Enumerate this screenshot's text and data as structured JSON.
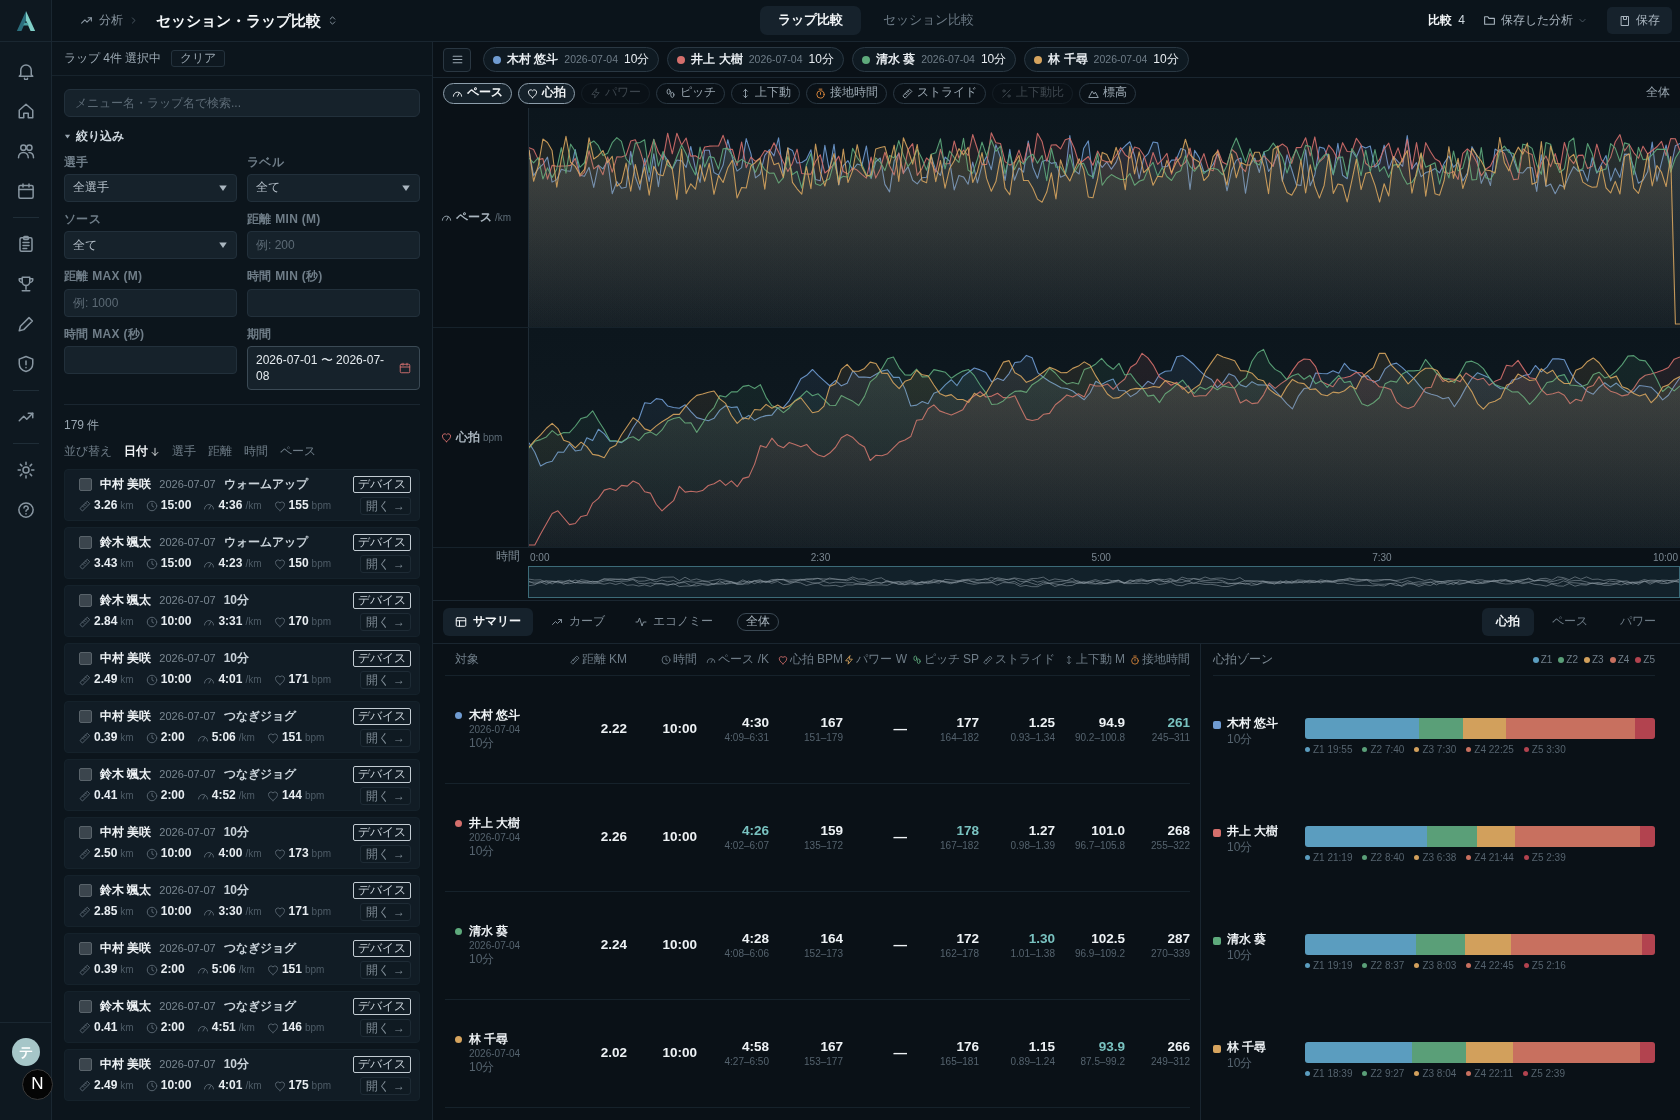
{
  "header": {
    "breadcrumb_parent": "分析",
    "title": "セッション・ラップ比較",
    "mode_tabs": [
      {
        "label": "ラップ比較",
        "selected": true
      },
      {
        "label": "セッション比較",
        "selected": false
      }
    ],
    "compare_label": "比較",
    "compare_count": "4",
    "saved_menu": "保存した分析",
    "save_button": "保存"
  },
  "sidebar": {
    "user_avatar": "テ",
    "dev_badge": "N"
  },
  "lap_panel": {
    "selection_text": "ラップ 4件 選択中",
    "clear_button": "クリア",
    "search": {
      "placeholder": "メニュー名・ラップ名で検索..."
    },
    "filter_toggle": {
      "label": "絞り込み",
      "expanded": true
    },
    "filters": [
      {
        "kind": "select",
        "label": "選手",
        "value": "全選手"
      },
      {
        "kind": "select",
        "label": "ラベル",
        "value": "全て"
      },
      {
        "kind": "select",
        "label": "ソース",
        "value": "全て"
      },
      {
        "kind": "input",
        "label": "距離 MIN (M)",
        "placeholder": "例: 200"
      },
      {
        "kind": "input",
        "label": "距離 MAX (M)",
        "placeholder": "例: 1000"
      },
      {
        "kind": "input",
        "label": "時間 MIN (秒)"
      },
      {
        "kind": "input",
        "label": "時間 MAX (秒)"
      },
      {
        "kind": "date",
        "label": "期間",
        "value": "2026-07-01 〜 2026-07-08"
      }
    ],
    "result_count": "179 件",
    "sort": {
      "label": "並び替え",
      "options": [
        {
          "label": "日付",
          "selected": true
        },
        {
          "label": "選手",
          "selected": false
        },
        {
          "label": "距離",
          "selected": false
        },
        {
          "label": "時間",
          "selected": false
        },
        {
          "label": "ペース",
          "selected": false
        }
      ]
    },
    "laps": [
      {
        "athlete": "中村 美咲",
        "date": "2026-07-07",
        "label": "ウォームアップ",
        "source": "デバイス",
        "checked": false,
        "metrics": [
          {
            "kind": "distance",
            "value": "3.26",
            "unit": "km"
          },
          {
            "kind": "time",
            "value": "15:00"
          },
          {
            "kind": "pace",
            "value": "4:36",
            "unit": "/km"
          },
          {
            "kind": "heart_rate",
            "value": "155",
            "unit": "bpm"
          }
        ],
        "open_button": "開く →"
      },
      {
        "athlete": "鈴木 颯太",
        "date": "2026-07-07",
        "label": "ウォームアップ",
        "source": "デバイス",
        "checked": false,
        "metrics": [
          {
            "kind": "distance",
            "value": "3.43",
            "unit": "km"
          },
          {
            "kind": "time",
            "value": "15:00"
          },
          {
            "kind": "pace",
            "value": "4:23",
            "unit": "/km"
          },
          {
            "kind": "heart_rate",
            "value": "150",
            "unit": "bpm"
          }
        ],
        "open_button": "開く →"
      },
      {
        "athlete": "鈴木 颯太",
        "date": "2026-07-07",
        "label": "10分",
        "source": "デバイス",
        "checked": false,
        "metrics": [
          {
            "kind": "distance",
            "value": "2.84",
            "unit": "km"
          },
          {
            "kind": "time",
            "value": "10:00"
          },
          {
            "kind": "pace",
            "value": "3:31",
            "unit": "/km"
          },
          {
            "kind": "heart_rate",
            "value": "170",
            "unit": "bpm"
          }
        ],
        "open_button": "開く →"
      },
      {
        "athlete": "中村 美咲",
        "date": "2026-07-07",
        "label": "10分",
        "source": "デバイス",
        "checked": false,
        "metrics": [
          {
            "kind": "distance",
            "value": "2.49",
            "unit": "km"
          },
          {
            "kind": "time",
            "value": "10:00"
          },
          {
            "kind": "pace",
            "value": "4:01",
            "unit": "/km"
          },
          {
            "kind": "heart_rate",
            "value": "171",
            "unit": "bpm"
          }
        ],
        "open_button": "開く →"
      },
      {
        "athlete": "中村 美咲",
        "date": "2026-07-07",
        "label": "つなぎジョグ",
        "source": "デバイス",
        "checked": false,
        "metrics": [
          {
            "kind": "distance",
            "value": "0.39",
            "unit": "km"
          },
          {
            "kind": "time",
            "value": "2:00"
          },
          {
            "kind": "pace",
            "value": "5:06",
            "unit": "/km"
          },
          {
            "kind": "heart_rate",
            "value": "151",
            "unit": "bpm"
          }
        ],
        "open_button": "開く →"
      },
      {
        "athlete": "鈴木 颯太",
        "date": "2026-07-07",
        "label": "つなぎジョグ",
        "source": "デバイス",
        "checked": false,
        "metrics": [
          {
            "kind": "distance",
            "value": "0.41",
            "unit": "km"
          },
          {
            "kind": "time",
            "value": "2:00"
          },
          {
            "kind": "pace",
            "value": "4:52",
            "unit": "/km"
          },
          {
            "kind": "heart_rate",
            "value": "144",
            "unit": "bpm"
          }
        ],
        "open_button": "開く →"
      },
      {
        "athlete": "中村 美咲",
        "date": "2026-07-07",
        "label": "10分",
        "source": "デバイス",
        "checked": false,
        "metrics": [
          {
            "kind": "distance",
            "value": "2.50",
            "unit": "km"
          },
          {
            "kind": "time",
            "value": "10:00"
          },
          {
            "kind": "pace",
            "value": "4:00",
            "unit": "/km"
          },
          {
            "kind": "heart_rate",
            "value": "173",
            "unit": "bpm"
          }
        ],
        "open_button": "開く →"
      },
      {
        "athlete": "鈴木 颯太",
        "date": "2026-07-07",
        "label": "10分",
        "source": "デバイス",
        "checked": false,
        "metrics": [
          {
            "kind": "distance",
            "value": "2.85",
            "unit": "km"
          },
          {
            "kind": "time",
            "value": "10:00"
          },
          {
            "kind": "pace",
            "value": "3:30",
            "unit": "/km"
          },
          {
            "kind": "heart_rate",
            "value": "171",
            "unit": "bpm"
          }
        ],
        "open_button": "開く →"
      },
      {
        "athlete": "中村 美咲",
        "date": "2026-07-07",
        "label": "つなぎジョグ",
        "source": "デバイス",
        "checked": false,
        "metrics": [
          {
            "kind": "distance",
            "value": "0.39",
            "unit": "km"
          },
          {
            "kind": "time",
            "value": "2:00"
          },
          {
            "kind": "pace",
            "value": "5:06",
            "unit": "/km"
          },
          {
            "kind": "heart_rate",
            "value": "151",
            "unit": "bpm"
          }
        ],
        "open_button": "開く →"
      },
      {
        "athlete": "鈴木 颯太",
        "date": "2026-07-07",
        "label": "つなぎジョグ",
        "source": "デバイス",
        "checked": false,
        "metrics": [
          {
            "kind": "distance",
            "value": "0.41",
            "unit": "km"
          },
          {
            "kind": "time",
            "value": "2:00"
          },
          {
            "kind": "pace",
            "value": "4:51",
            "unit": "/km"
          },
          {
            "kind": "heart_rate",
            "value": "146",
            "unit": "bpm"
          }
        ],
        "open_button": "開く →"
      },
      {
        "athlete": "中村 美咲",
        "date": "2026-07-07",
        "label": "10分",
        "source": "デバイス",
        "checked": false,
        "metrics": [
          {
            "kind": "distance",
            "value": "2.49",
            "unit": "km"
          },
          {
            "kind": "time",
            "value": "10:00"
          },
          {
            "kind": "pace",
            "value": "4:01",
            "unit": "/km"
          },
          {
            "kind": "heart_rate",
            "value": "175",
            "unit": "bpm"
          }
        ],
        "open_button": "開く →"
      }
    ]
  },
  "compare_chips": [
    {
      "name": "木村 悠斗",
      "date": "2026-07-04",
      "lap": "10分",
      "color": "#6f9bd1"
    },
    {
      "name": "井上 大樹",
      "date": "2026-07-04",
      "lap": "10分",
      "color": "#d46f6c"
    },
    {
      "name": "清水 葵",
      "date": "2026-07-04",
      "lap": "10分",
      "color": "#5eaa7c"
    },
    {
      "name": "林 千尋",
      "date": "2026-07-04",
      "lap": "10分",
      "color": "#d6a45e"
    }
  ],
  "metric_toggles": [
    {
      "kind": "pace",
      "label": "ペース",
      "selected": true,
      "disabled": false
    },
    {
      "kind": "heart_rate",
      "label": "心拍",
      "selected": true,
      "disabled": false
    },
    {
      "kind": "power",
      "label": "パワー",
      "selected": false,
      "disabled": true
    },
    {
      "kind": "cadence",
      "label": "ピッチ",
      "selected": false,
      "disabled": false
    },
    {
      "kind": "vertical_oscillation",
      "label": "上下動",
      "selected": false,
      "disabled": false
    },
    {
      "kind": "ground_contact",
      "label": "接地時間",
      "selected": false,
      "disabled": false
    },
    {
      "kind": "stride",
      "label": "ストライド",
      "selected": false,
      "disabled": false
    },
    {
      "kind": "vertical_ratio",
      "label": "上下動比",
      "selected": false,
      "disabled": true
    },
    {
      "kind": "elevation",
      "label": "標高",
      "selected": false,
      "disabled": false
    }
  ],
  "chart_scope": "全体",
  "charts": [
    {
      "kind": "pace",
      "label": "ペース",
      "unit": "/km"
    },
    {
      "kind": "heart_rate",
      "label": "心拍",
      "unit": "bpm"
    }
  ],
  "time_axis": {
    "label": "時間",
    "ticks": [
      "0:00",
      "2:30",
      "5:00",
      "7:30",
      "10:00"
    ]
  },
  "analysis_tabs": [
    {
      "kind": "summary",
      "label": "サマリー",
      "selected": true
    },
    {
      "kind": "curve",
      "label": "カーブ",
      "selected": false
    },
    {
      "kind": "economy",
      "label": "エコノミー",
      "selected": false
    }
  ],
  "analysis_scope": "全体",
  "zone_metric_tabs": [
    {
      "label": "心拍",
      "selected": true
    },
    {
      "label": "ペース",
      "selected": false
    },
    {
      "label": "パワー",
      "selected": false
    }
  ],
  "summary_table": {
    "target_header": "対象",
    "columns": [
      {
        "kind": "distance",
        "label": "距離 KM"
      },
      {
        "kind": "time",
        "label": "時間"
      },
      {
        "kind": "pace",
        "label": "ペース /K"
      },
      {
        "kind": "heart_rate",
        "label": "心拍 BPM"
      },
      {
        "kind": "power",
        "label": "パワー W"
      },
      {
        "kind": "cadence",
        "label": "ピッチ SP"
      },
      {
        "kind": "stride",
        "label": "ストライド"
      },
      {
        "kind": "vertical_oscillation",
        "label": "上下動 M"
      },
      {
        "kind": "ground_contact",
        "label": "接地時間"
      }
    ],
    "rows": [
      {
        "name": "木村 悠斗",
        "date": "2026-07-04",
        "lap": "10分",
        "color": "#6f9bd1",
        "cells": [
          {
            "value": "2.22",
            "best": false
          },
          {
            "value": "10:00",
            "best": false
          },
          {
            "value": "4:30",
            "range": "4:09–6:31",
            "best": false
          },
          {
            "value": "167",
            "range": "151–179",
            "best": false
          },
          {
            "value": "—",
            "best": false
          },
          {
            "value": "177",
            "range": "164–182",
            "best": false
          },
          {
            "value": "1.25",
            "range": "0.93–1.34",
            "best": false
          },
          {
            "value": "94.9",
            "range": "90.2–100.8",
            "best": false
          },
          {
            "value": "261",
            "range": "245–311",
            "best": true
          }
        ]
      },
      {
        "name": "井上 大樹",
        "date": "2026-07-04",
        "lap": "10分",
        "color": "#d46f6c",
        "cells": [
          {
            "value": "2.26",
            "best": false
          },
          {
            "value": "10:00",
            "best": false
          },
          {
            "value": "4:26",
            "range": "4:02–6:07",
            "best": true
          },
          {
            "value": "159",
            "range": "135–172",
            "best": false
          },
          {
            "value": "—",
            "best": false
          },
          {
            "value": "178",
            "range": "167–182",
            "best": true
          },
          {
            "value": "1.27",
            "range": "0.98–1.39",
            "best": false
          },
          {
            "value": "101.0",
            "range": "96.7–105.8",
            "best": false
          },
          {
            "value": "268",
            "range": "255–322",
            "best": false
          }
        ]
      },
      {
        "name": "清水 葵",
        "date": "2026-07-04",
        "lap": "10分",
        "color": "#5eaa7c",
        "cells": [
          {
            "value": "2.24",
            "best": false
          },
          {
            "value": "10:00",
            "best": false
          },
          {
            "value": "4:28",
            "range": "4:08–6:06",
            "best": false
          },
          {
            "value": "164",
            "range": "152–173",
            "best": false
          },
          {
            "value": "—",
            "best": false
          },
          {
            "value": "172",
            "range": "162–178",
            "best": false
          },
          {
            "value": "1.30",
            "range": "1.01–1.38",
            "best": true
          },
          {
            "value": "102.5",
            "range": "96.9–109.2",
            "best": false
          },
          {
            "value": "287",
            "range": "270–339",
            "best": false
          }
        ]
      },
      {
        "name": "林 千尋",
        "date": "2026-07-04",
        "lap": "10分",
        "color": "#d6a45e",
        "cells": [
          {
            "value": "2.02",
            "best": false
          },
          {
            "value": "10:00",
            "best": false
          },
          {
            "value": "4:58",
            "range": "4:27–6:50",
            "best": false
          },
          {
            "value": "167",
            "range": "153–177",
            "best": false
          },
          {
            "value": "—",
            "best": false
          },
          {
            "value": "176",
            "range": "165–181",
            "best": false
          },
          {
            "value": "1.15",
            "range": "0.89–1.24",
            "best": false
          },
          {
            "value": "93.9",
            "range": "87.5–99.2",
            "best": true
          },
          {
            "value": "266",
            "range": "249–312",
            "best": false
          }
        ]
      }
    ]
  },
  "zone_panel": {
    "title": "心拍ゾーン",
    "legend": [
      {
        "label": "Z1",
        "color": "#5b9dbf"
      },
      {
        "label": "Z2",
        "color": "#5a9f78"
      },
      {
        "label": "Z3",
        "color": "#d2a05c"
      },
      {
        "label": "Z4",
        "color": "#c8705f"
      },
      {
        "label": "Z5",
        "color": "#b2434f"
      }
    ],
    "rows": [
      {
        "name": "木村 悠斗",
        "lap": "10分",
        "color": "#6f9bd1",
        "zones": [
          "Z1 19:55",
          "Z2 7:40",
          "Z3 7:30",
          "Z4 22:25",
          "Z5 3:30"
        ]
      },
      {
        "name": "井上 大樹",
        "lap": "10分",
        "color": "#d46f6c",
        "zones": [
          "Z1 21:19",
          "Z2 8:40",
          "Z3 6:38",
          "Z4 21:44",
          "Z5 2:39"
        ]
      },
      {
        "name": "清水 葵",
        "lap": "10分",
        "color": "#5eaa7c",
        "zones": [
          "Z1 19:19",
          "Z2 8:37",
          "Z3 8:03",
          "Z4 22:45",
          "Z5 2:16"
        ]
      },
      {
        "name": "林 千尋",
        "lap": "10分",
        "color": "#d6a45e",
        "zones": [
          "Z1 18:39",
          "Z2 9:27",
          "Z3 8:04",
          "Z4 22:11",
          "Z5 2:39"
        ]
      }
    ]
  }
}
